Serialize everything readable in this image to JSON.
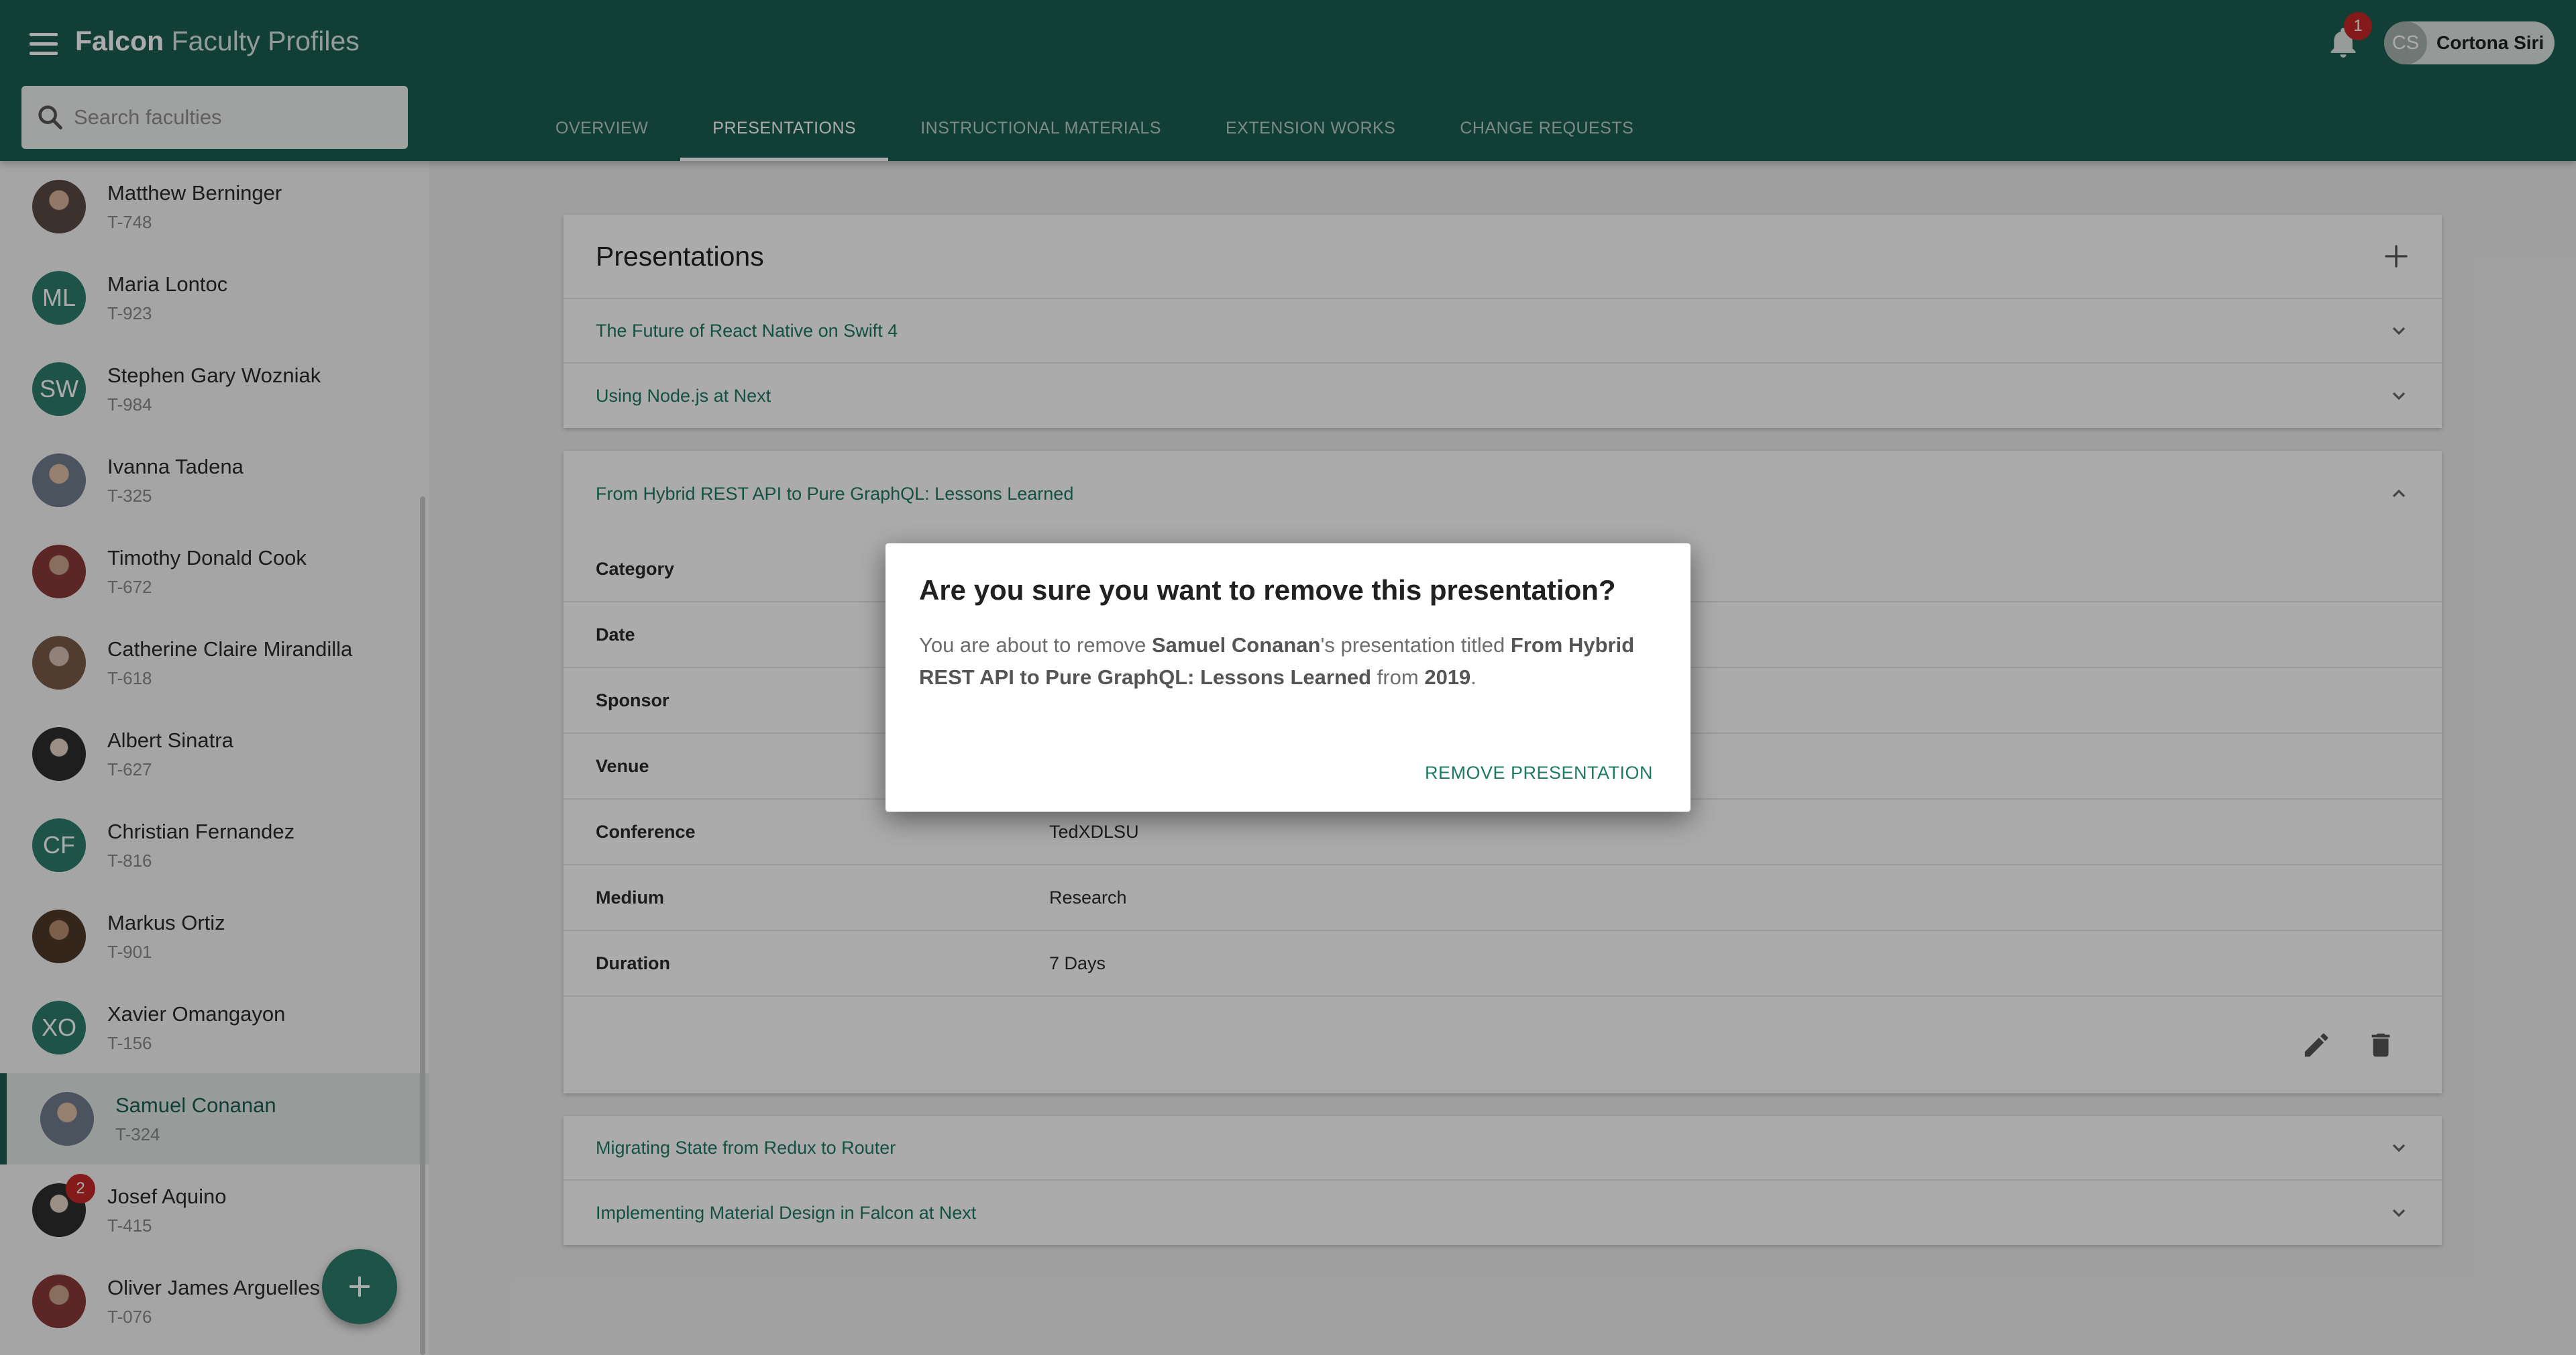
{
  "app": {
    "brand_bold": "Falcon",
    "brand_light": "Faculty Profiles"
  },
  "search": {
    "placeholder": "Search faculties"
  },
  "tabs": [
    {
      "label": "OVERVIEW",
      "active": false
    },
    {
      "label": "PRESENTATIONS",
      "active": true
    },
    {
      "label": "INSTRUCTIONAL MATERIALS",
      "active": false
    },
    {
      "label": "EXTENSION WORKS",
      "active": false
    },
    {
      "label": "CHANGE REQUESTS",
      "active": false
    }
  ],
  "notifications": {
    "count": "1",
    "icon": "bell-icon"
  },
  "user": {
    "initials": "CS",
    "name": "Cortona Siri"
  },
  "faculty_list": [
    {
      "name": "Matthew Berninger",
      "id": "T-748"
    },
    {
      "name": "Maria Lontoc",
      "id": "T-923",
      "initials": "ML"
    },
    {
      "name": "Stephen Gary Wozniak",
      "id": "T-984",
      "initials": "SW"
    },
    {
      "name": "Ivanna Tadena",
      "id": "T-325"
    },
    {
      "name": "Timothy Donald Cook",
      "id": "T-672"
    },
    {
      "name": "Catherine Claire Mirandilla",
      "id": "T-618"
    },
    {
      "name": "Albert Sinatra",
      "id": "T-627"
    },
    {
      "name": "Christian Fernandez",
      "id": "T-816",
      "initials": "CF"
    },
    {
      "name": "Markus Ortiz",
      "id": "T-901"
    },
    {
      "name": "Xavier Omangayon",
      "id": "T-156",
      "initials": "XO"
    },
    {
      "name": "Samuel Conanan",
      "id": "T-324",
      "selected": true
    },
    {
      "name": "Josef Aquino",
      "id": "T-415",
      "badge": "2"
    },
    {
      "name": "Oliver James Arguelles",
      "id": "T-076"
    }
  ],
  "presentations": {
    "title": "Presentations",
    "collapsed_top": [
      "The Future of React Native on Swift 4",
      "Using Node.js at Next"
    ],
    "expanded": {
      "title": "From Hybrid REST API to Pure GraphQL: Lessons Learned",
      "details": [
        {
          "label": "Category",
          "value": ""
        },
        {
          "label": "Date",
          "value": ""
        },
        {
          "label": "Sponsor",
          "value": ""
        },
        {
          "label": "Venue",
          "value": ""
        },
        {
          "label": "Conference",
          "value": "TedXDLSU"
        },
        {
          "label": "Medium",
          "value": "Research"
        },
        {
          "label": "Duration",
          "value": "7 Days"
        }
      ]
    },
    "collapsed_bottom": [
      "Migrating State from Redux to Router",
      "Implementing Material Design in Falcon at Next"
    ]
  },
  "dialog": {
    "title": "Are you sure you want to remove this presentation?",
    "body_prefix": "You are about to remove ",
    "faculty": "Samuel Conanan",
    "body_mid": "'s presentation titled ",
    "presentation": "From Hybrid REST API to Pure GraphQL: Lessons Learned",
    "body_from": " from ",
    "year": "2019",
    "body_end": ".",
    "action": "REMOVE PRESENTATION"
  },
  "colors": {
    "primary": "#1b5e4f",
    "accent_text": "#1e7a63",
    "badge": "#c62828"
  }
}
